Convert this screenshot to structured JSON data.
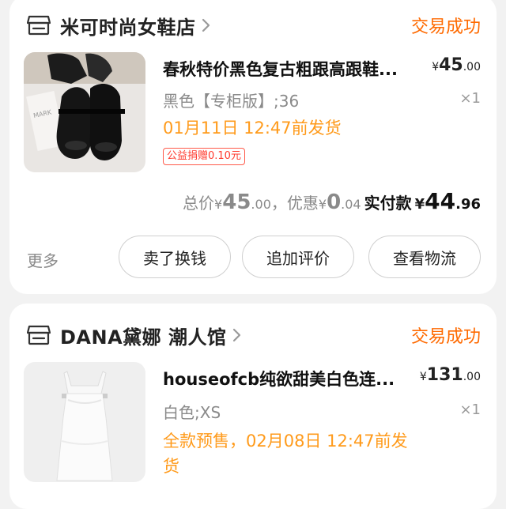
{
  "orders": [
    {
      "shop_name": "米可时尚女鞋店",
      "status": "交易成功",
      "product_title": "春秋特价黑色复古粗跟高跟鞋...",
      "price_symbol": "¥",
      "price_int": "45",
      "price_dec": ".00",
      "spec": "黑色【专柜版】;36",
      "quantity": "×1",
      "ship_text": "01月11日 12:47前发货",
      "charity_tag": "公益捐赠0.10元",
      "totals": {
        "total_label": "总价",
        "total_int": "45",
        "total_dec": ".00",
        "discount_label": "，优惠",
        "discount_int": "0",
        "discount_dec": ".04",
        "paid_label": "实付款",
        "paid_int": "44",
        "paid_dec": ".96"
      },
      "more_label": "更多",
      "buttons": [
        "卖了换钱",
        "追加评价",
        "查看物流"
      ]
    },
    {
      "shop_name": "DANA黛娜 潮人馆",
      "status": "交易成功",
      "product_title": "houseofcb纯欲甜美白色连...",
      "price_symbol": "¥",
      "price_int": "131",
      "price_dec": ".00",
      "spec": "白色;XS",
      "quantity": "×1",
      "ship_text": "全款预售，02月08日 12:47前发货"
    }
  ],
  "colors": {
    "accent_orange": "#ff6a00",
    "ship_orange": "#ff9a1a",
    "charity_red": "#ff3b2f",
    "background": "#f2f2f2"
  },
  "icons": [
    "shop-icon",
    "chevron-right-icon"
  ]
}
